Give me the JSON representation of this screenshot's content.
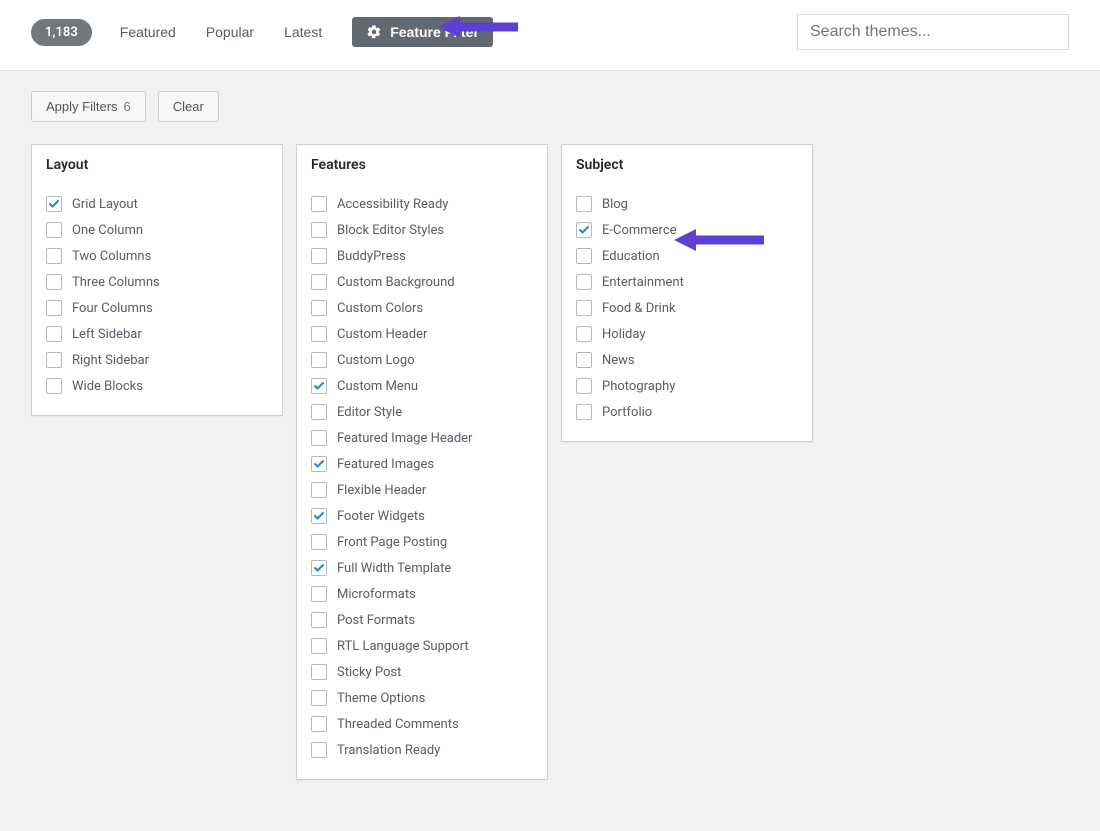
{
  "header": {
    "count": "1,183",
    "tabs": [
      "Featured",
      "Popular",
      "Latest"
    ],
    "feature_filter_label": "Feature Filter",
    "search_placeholder": "Search themes..."
  },
  "actions": {
    "apply_label": "Apply Filters",
    "apply_count": "6",
    "clear_label": "Clear"
  },
  "panels": {
    "layout": {
      "title": "Layout",
      "items": [
        {
          "label": "Grid Layout",
          "checked": true
        },
        {
          "label": "One Column",
          "checked": false
        },
        {
          "label": "Two Columns",
          "checked": false
        },
        {
          "label": "Three Columns",
          "checked": false
        },
        {
          "label": "Four Columns",
          "checked": false
        },
        {
          "label": "Left Sidebar",
          "checked": false
        },
        {
          "label": "Right Sidebar",
          "checked": false
        },
        {
          "label": "Wide Blocks",
          "checked": false
        }
      ]
    },
    "features": {
      "title": "Features",
      "items": [
        {
          "label": "Accessibility Ready",
          "checked": false
        },
        {
          "label": "Block Editor Styles",
          "checked": false
        },
        {
          "label": "BuddyPress",
          "checked": false
        },
        {
          "label": "Custom Background",
          "checked": false
        },
        {
          "label": "Custom Colors",
          "checked": false
        },
        {
          "label": "Custom Header",
          "checked": false
        },
        {
          "label": "Custom Logo",
          "checked": false
        },
        {
          "label": "Custom Menu",
          "checked": true
        },
        {
          "label": "Editor Style",
          "checked": false
        },
        {
          "label": "Featured Image Header",
          "checked": false
        },
        {
          "label": "Featured Images",
          "checked": true
        },
        {
          "label": "Flexible Header",
          "checked": false
        },
        {
          "label": "Footer Widgets",
          "checked": true
        },
        {
          "label": "Front Page Posting",
          "checked": false
        },
        {
          "label": "Full Width Template",
          "checked": true
        },
        {
          "label": "Microformats",
          "checked": false
        },
        {
          "label": "Post Formats",
          "checked": false
        },
        {
          "label": "RTL Language Support",
          "checked": false
        },
        {
          "label": "Sticky Post",
          "checked": false
        },
        {
          "label": "Theme Options",
          "checked": false
        },
        {
          "label": "Threaded Comments",
          "checked": false
        },
        {
          "label": "Translation Ready",
          "checked": false
        }
      ]
    },
    "subject": {
      "title": "Subject",
      "items": [
        {
          "label": "Blog",
          "checked": false
        },
        {
          "label": "E-Commerce",
          "checked": true
        },
        {
          "label": "Education",
          "checked": false
        },
        {
          "label": "Entertainment",
          "checked": false
        },
        {
          "label": "Food & Drink",
          "checked": false
        },
        {
          "label": "Holiday",
          "checked": false
        },
        {
          "label": "News",
          "checked": false
        },
        {
          "label": "Photography",
          "checked": false
        },
        {
          "label": "Portfolio",
          "checked": false
        }
      ]
    }
  },
  "annotations": {
    "arrow_color": "#5D3FD3"
  }
}
